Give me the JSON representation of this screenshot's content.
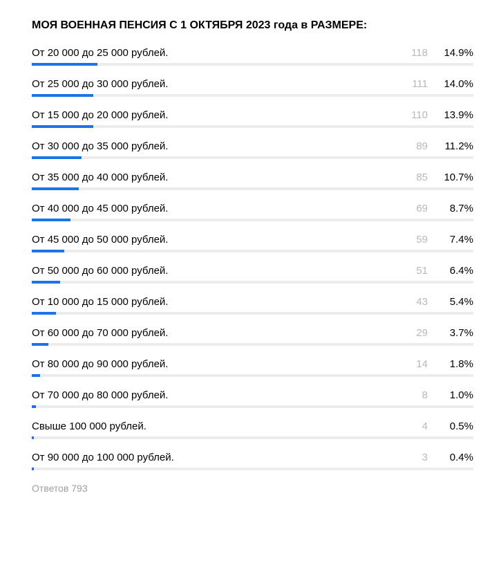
{
  "title": "МОЯ ВОЕННАЯ ПЕНСИЯ С 1 ОКТЯБРЯ 2023 года в РАЗМЕРЕ:",
  "footer": "Ответов 793",
  "rows": [
    {
      "label": "От 20 000 до 25 000 рублей.",
      "count": "118",
      "pct": "14.9%",
      "w": 14.9
    },
    {
      "label": "От 25 000 до 30 000 рублей.",
      "count": "111",
      "pct": "14.0%",
      "w": 14.0
    },
    {
      "label": "От 15 000 до 20 000 рублей.",
      "count": "110",
      "pct": "13.9%",
      "w": 13.9
    },
    {
      "label": "От 30 000 до 35 000 рублей.",
      "count": "89",
      "pct": "11.2%",
      "w": 11.2
    },
    {
      "label": "От 35 000 до 40 000 рублей.",
      "count": "85",
      "pct": "10.7%",
      "w": 10.7
    },
    {
      "label": "От  40 000  до 45 000  рублей.",
      "count": "69",
      "pct": "8.7%",
      "w": 8.7
    },
    {
      "label": "От 45 000 до 50 000 рублей.",
      "count": "59",
      "pct": "7.4%",
      "w": 7.4
    },
    {
      "label": "От 50 000 до 60 000 рублей.",
      "count": "51",
      "pct": "6.4%",
      "w": 6.4
    },
    {
      "label": "От 10 000 до 15 000 рублей.",
      "count": "43",
      "pct": "5.4%",
      "w": 5.4
    },
    {
      "label": "От 60 000 до 70 000 рублей.",
      "count": "29",
      "pct": "3.7%",
      "w": 3.7
    },
    {
      "label": "От 80 000 до 90 000 рублей.",
      "count": "14",
      "pct": "1.8%",
      "w": 1.8
    },
    {
      "label": "От 70 000 до 80 000 рублей.",
      "count": "8",
      "pct": "1.0%",
      "w": 1.0
    },
    {
      "label": "Свыше 100 000 рублей.",
      "count": "4",
      "pct": "0.5%",
      "w": 0.5
    },
    {
      "label": "От 90 000 до 100 000 рублей.",
      "count": "3",
      "pct": "0.4%",
      "w": 0.4
    }
  ],
  "chart_data": {
    "type": "bar",
    "title": "МОЯ ВОЕННАЯ ПЕНСИЯ С 1 ОКТЯБРЯ 2023 года в РАЗМЕРЕ:",
    "xlabel": "",
    "ylabel": "",
    "total_responses": 793,
    "categories": [
      "От 20 000 до 25 000 рублей.",
      "От 25 000 до 30 000 рублей.",
      "От 15 000 до 20 000 рублей.",
      "От 30 000 до 35 000 рублей.",
      "От 35 000 до 40 000 рублей.",
      "От 40 000 до 45 000 рублей.",
      "От 45 000 до 50 000 рублей.",
      "От 50 000 до 60 000 рублей.",
      "От 10 000 до 15 000 рублей.",
      "От 60 000 до 70 000 рублей.",
      "От 80 000 до 90 000 рублей.",
      "От 70 000 до 80 000 рублей.",
      "Свыше 100 000 рублей.",
      "От 90 000 до 100 000 рублей."
    ],
    "series": [
      {
        "name": "count",
        "values": [
          118,
          111,
          110,
          89,
          85,
          69,
          59,
          51,
          43,
          29,
          14,
          8,
          4,
          3
        ]
      },
      {
        "name": "percent",
        "values": [
          14.9,
          14.0,
          13.9,
          11.2,
          10.7,
          8.7,
          7.4,
          6.4,
          5.4,
          3.7,
          1.8,
          1.0,
          0.5,
          0.4
        ]
      }
    ]
  }
}
